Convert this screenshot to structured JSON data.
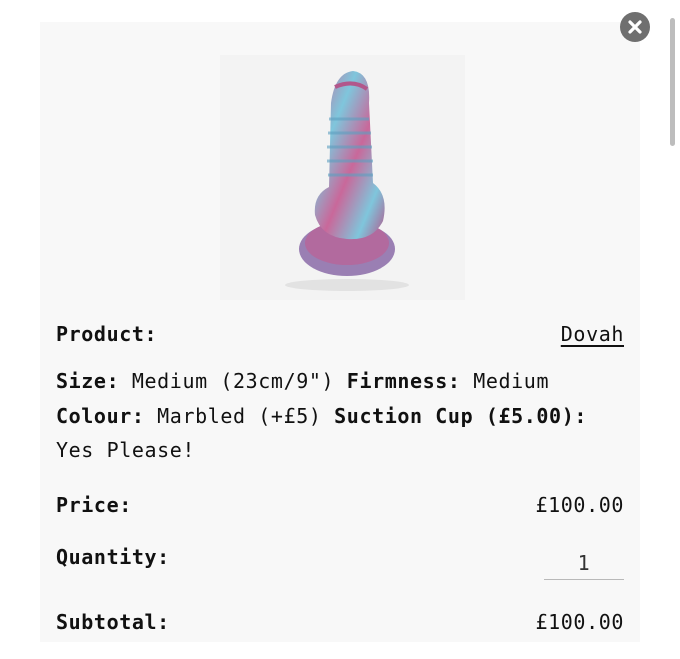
{
  "product": {
    "label": "Product:",
    "name": "Dovah",
    "image_icon": "product-photo"
  },
  "options": {
    "size_label": "Size:",
    "size_value": "Medium (23cm/9\")",
    "firmness_label": "Firmness:",
    "firmness_value": "Medium",
    "colour_label": "Colour:",
    "colour_value": "Marbled (+£5)",
    "suction_label": "Suction Cup (£5.00):",
    "suction_value": "Yes Please!"
  },
  "price": {
    "label": "Price:",
    "value": "£100.00"
  },
  "quantity": {
    "label": "Quantity:",
    "value": "1"
  },
  "subtotal": {
    "label": "Subtotal:",
    "value": "£100.00"
  },
  "colors": {
    "pink": "#c9689a",
    "blue": "#7fc6dc",
    "close": "#6f6f6f"
  }
}
